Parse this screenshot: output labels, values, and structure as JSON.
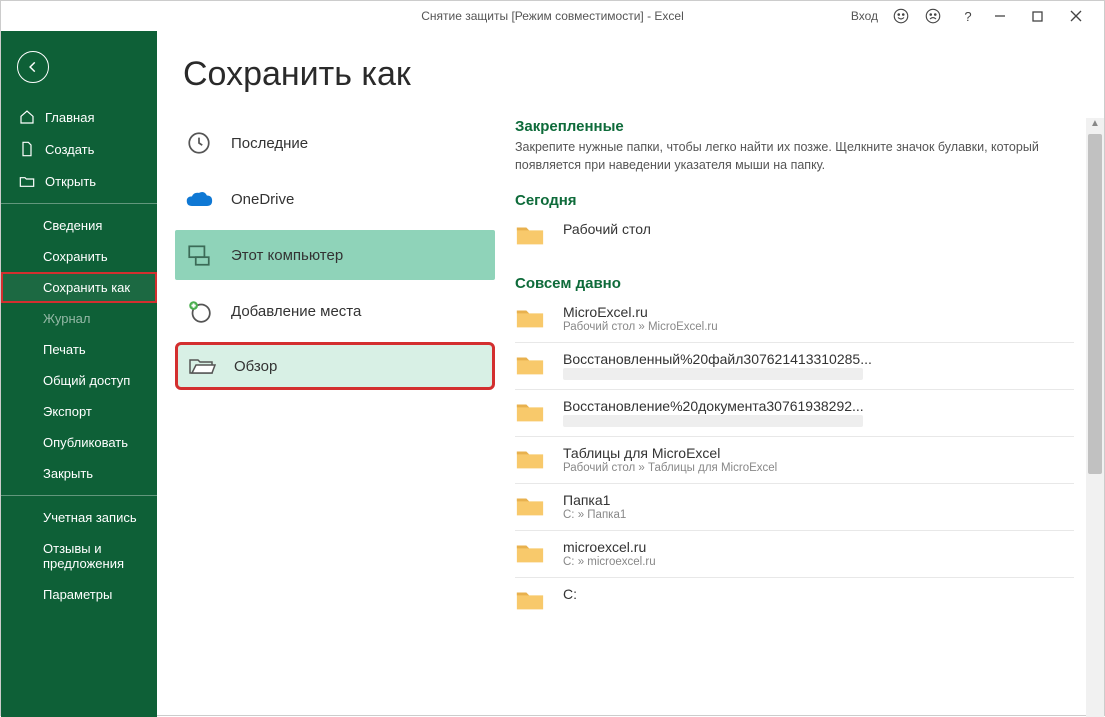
{
  "titlebar": {
    "document_title": "Снятие защиты  [Режим совместимости]  -  Excel",
    "signin": "Вход"
  },
  "sidebar": {
    "home": "Главная",
    "new": "Создать",
    "open": "Открыть",
    "info": "Сведения",
    "save": "Сохранить",
    "save_as": "Сохранить как",
    "journal": "Журнал",
    "print": "Печать",
    "share": "Общий доступ",
    "export": "Экспорт",
    "publish": "Опубликовать",
    "close": "Закрыть",
    "account": "Учетная запись",
    "feedback": "Отзывы и предложения",
    "options": "Параметры"
  },
  "page": {
    "title": "Сохранить как"
  },
  "locations": {
    "recent": "Последние",
    "onedrive": "OneDrive",
    "this_pc": "Этот компьютер",
    "add_place": "Добавление места",
    "browse": "Обзор"
  },
  "right": {
    "pinned_head": "Закрепленные",
    "pinned_sub": "Закрепите нужные папки, чтобы легко найти их позже. Щелкните значок булавки, который появляется при наведении указателя мыши на папку.",
    "today_head": "Сегодня",
    "older_head": "Совсем давно",
    "folders_today": [
      {
        "name": "Рабочий стол",
        "path": ""
      }
    ],
    "folders_older": [
      {
        "name": "MicroExcel.ru",
        "path": "Рабочий стол » MicroExcel.ru"
      },
      {
        "name": "Восстановленный%20файл307621413310285...",
        "path": "blur"
      },
      {
        "name": "Восстановление%20документа30761938292...",
        "path": "blur"
      },
      {
        "name": "Таблицы для MicroExcel",
        "path": "Рабочий стол » Таблицы для MicroExcel"
      },
      {
        "name": "Папка1",
        "path": "C: » Папка1"
      },
      {
        "name": "microexcel.ru",
        "path": "C: » microexcel.ru"
      },
      {
        "name": "C:",
        "path": ""
      }
    ]
  }
}
